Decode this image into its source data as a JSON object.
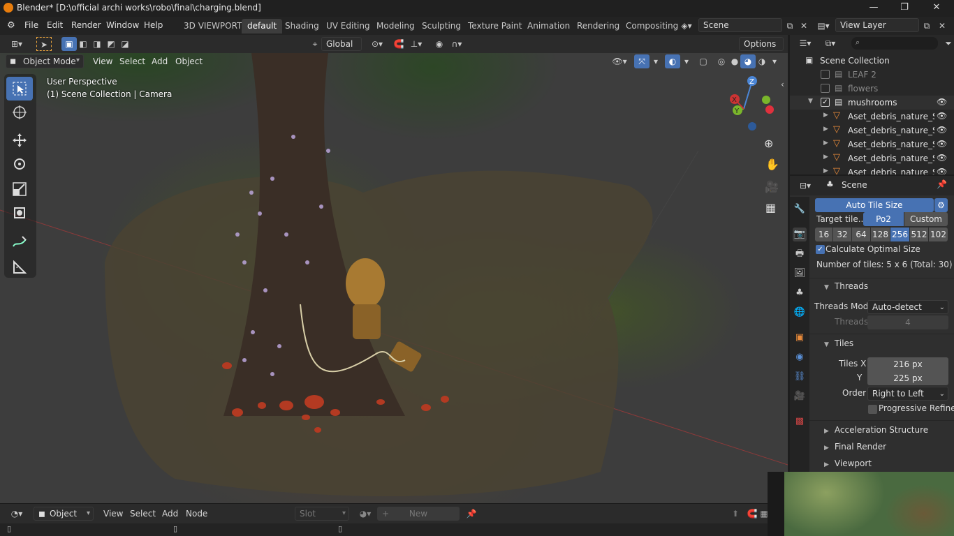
{
  "titlebar": {
    "title": "Blender* [D:\\official archi works\\robo\\final\\charging.blend]",
    "minimize": "—",
    "maximize": "❐",
    "close": "✕"
  },
  "menu": {
    "items": [
      "File",
      "Edit",
      "Render",
      "Window",
      "Help"
    ]
  },
  "workspaces": {
    "tabs": [
      "3D VIEWPORT",
      "default",
      "Shading",
      "UV Editing",
      "Modeling",
      "Sculpting",
      "Texture Paint",
      "Animation",
      "Rendering",
      "Compositing"
    ],
    "active": "default"
  },
  "scene_selector": {
    "value": "Scene"
  },
  "view_layer": {
    "value": "View Layer"
  },
  "toolheader": {
    "orientation": "Global",
    "options": "Options"
  },
  "viewport_header": {
    "mode": "Object Mode",
    "items": [
      "View",
      "Select",
      "Add",
      "Object"
    ]
  },
  "viewport": {
    "perspective": "User Perspective",
    "collection": "(1) Scene Collection | Camera"
  },
  "gizmo": {
    "x": "X",
    "y": "Y",
    "z": "Z"
  },
  "outliner": {
    "search_placeholder": "",
    "rows": [
      {
        "label": "Scene Collection"
      },
      {
        "label": "LEAF 2"
      },
      {
        "label": "flowers"
      },
      {
        "label": "mushrooms"
      },
      {
        "label": "Aset_debris_nature_S_rdl"
      },
      {
        "label": "Aset_debris_nature_S_rdl"
      },
      {
        "label": "Aset_debris_nature_S_rdl"
      },
      {
        "label": "Aset_debris_nature_S_rdl"
      },
      {
        "label": "Aset_debris_nature_S_rdl"
      }
    ]
  },
  "properties": {
    "context": "Scene",
    "auto_tile_size": "Auto Tile Size",
    "target_tile_label": "Target tile...",
    "po2": "Po2",
    "custom": "Custom",
    "tile_sizes": [
      "16",
      "32",
      "64",
      "128",
      "256",
      "512",
      "102"
    ],
    "tile_sizes_active": "256",
    "calc_optimal": "Calculate Optimal Size",
    "num_tiles": "Number of tiles: 5 x 6 (Total: 30)",
    "threads_section": "Threads",
    "threads_mode_label": "Threads Mod",
    "threads_mode_value": "Auto-detect",
    "threads_label": "Threads",
    "threads_value": "4",
    "tiles_section": "Tiles",
    "tiles_x_label": "Tiles X",
    "tiles_x_value": "216 px",
    "tiles_y_label": "Y",
    "tiles_y_value": "225 px",
    "order_label": "Order",
    "order_value": "Right to Left",
    "progressive_refine": "Progressive Refine",
    "accel": "Acceleration Structure",
    "final_render": "Final Render",
    "viewport_section": "Viewport"
  },
  "bottom": {
    "mode": "Object",
    "items": [
      "View",
      "Select",
      "Add",
      "Node"
    ],
    "slot": "Slot",
    "new": "New"
  },
  "colors": {
    "accent": "#4772b3",
    "panel": "#2f2f2f",
    "header": "#232323"
  }
}
